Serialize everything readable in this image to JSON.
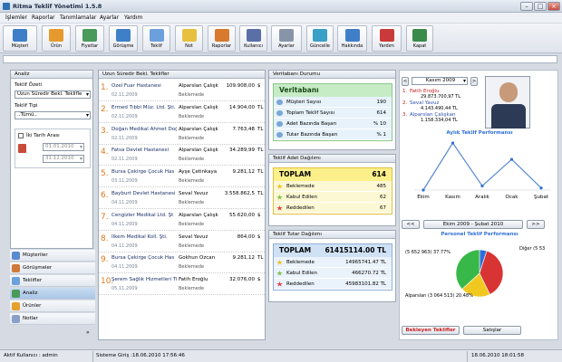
{
  "window": {
    "title": "Ritma Teklif Yönetimi 1.5.8"
  },
  "menu": [
    "İşlemler",
    "Raporlar",
    "Tanımlamalar",
    "Ayarlar",
    "Yardım"
  ],
  "toolbar": [
    {
      "label": "Müşteri",
      "color": "#3f7fc7",
      "icon": "customers-icon"
    },
    {
      "label": "Ürün",
      "color": "#e69a2e",
      "icon": "product-icon"
    },
    {
      "label": "Fiyatlar",
      "color": "#4a9a5a",
      "icon": "prices-icon"
    },
    {
      "label": "Görüşme",
      "color": "#3f7fc7",
      "icon": "meeting-icon"
    },
    {
      "label": "Teklif",
      "color": "#6ca0dc",
      "icon": "offer-icon"
    },
    {
      "label": "Not",
      "color": "#e8c040",
      "icon": "note-icon"
    },
    {
      "label": "Raporlar",
      "color": "#d9792e",
      "icon": "reports-icon"
    },
    {
      "label": "Kullanıcı",
      "color": "#5a6fa8",
      "icon": "user-icon"
    },
    {
      "label": "Ayarlar",
      "color": "#8895a8",
      "icon": "settings-icon"
    },
    {
      "label": "Güncelle",
      "color": "#3aa0c8",
      "icon": "update-icon"
    },
    {
      "label": "Hakkında",
      "color": "#3f7fc7",
      "icon": "about-icon"
    },
    {
      "label": "Yardım",
      "color": "#c93a3a",
      "icon": "help-icon"
    },
    {
      "label": "Kapat",
      "color": "#3a8a4a",
      "icon": "exit-icon"
    }
  ],
  "analysis": {
    "header": "Analiz",
    "summary_label": "Teklif Özeti",
    "summary_value": "Uzun Süredir Bekl. Teklifle",
    "type_label": "Teklif Tipi",
    "type_value": "..Tümü..",
    "date_range_label": "İki Tarih Arası",
    "date_from": "01.01.2010",
    "date_to": "31.12.2010"
  },
  "nav": [
    "Müşteriler",
    "Görüşmeler",
    "Teklifler",
    "Analiz",
    "Ürünler",
    "Notlar"
  ],
  "offers": {
    "header": "Uzun Süredir Bekl. Teklifler",
    "rows": [
      {
        "n": "1.",
        "name": "Özel Fuar Hastanesi",
        "date": "02.11.2009",
        "user": "Alparslan Çalışk",
        "status": "Beklemede",
        "amount": "109.908,00",
        "cur": "$"
      },
      {
        "n": "2.",
        "name": "Ermed Tıbbi Müz. Ltd. Şti.",
        "date": "02.11.2009",
        "user": "Alparslan Çalışk",
        "status": "Beklemede",
        "amount": "14.904,00",
        "cur": "TL"
      },
      {
        "n": "3.",
        "name": "Doğan Medikal Ahmet Doğ",
        "date": "02.11.2009",
        "user": "Alparslan Çalışk",
        "status": "Beklemede",
        "amount": "7.763,48",
        "cur": "TL"
      },
      {
        "n": "4.",
        "name": "Fatsa Devlet Hastanesi",
        "date": "02.11.2009",
        "user": "Alparslan Çalışk",
        "status": "Beklemede",
        "amount": "34.289,99",
        "cur": "TL"
      },
      {
        "n": "5.",
        "name": "Bursa Çekirge Çocuk Has",
        "date": "03.11.2009",
        "user": "Ayşe Çetinkaya",
        "status": "Beklemede",
        "amount": "9.281,12",
        "cur": "TL"
      },
      {
        "n": "6.",
        "name": "Bayburt Devlet Hastanesi",
        "date": "04.11.2009",
        "user": "Seval Yavuz",
        "status": "Beklemede",
        "amount": "3.558.862,5",
        "cur": "TL"
      },
      {
        "n": "7.",
        "name": "Cengizler Medikal Ltd. Şt",
        "date": "04.11.2009",
        "user": "Alparslan Çalışk",
        "status": "Beklemede",
        "amount": "55.620,00",
        "cur": "$"
      },
      {
        "n": "8.",
        "name": "İlkem Medikal Koll. Şti.",
        "date": "04.11.2009",
        "user": "Seval Yavuz",
        "status": "Beklemede",
        "amount": "864,00",
        "cur": "$"
      },
      {
        "n": "9.",
        "name": "Bursa Çekirge Çocuk Has",
        "date": "04.11.2009",
        "user": "Gokhun Özcan",
        "status": "Beklemede",
        "amount": "9.281,12",
        "cur": "TL"
      },
      {
        "n": "10.",
        "name": "Şerem Sağlık Hizmetleri Ti",
        "date": "05.11.2009",
        "user": "Fatih Eroğlu",
        "status": "Beklemede",
        "amount": "32.076,00",
        "cur": "$"
      }
    ]
  },
  "db": {
    "header": "Veritabanı Durumu",
    "title": "Veritabanı",
    "rows": [
      {
        "label": "Müşteri Sayısı",
        "value": "190"
      },
      {
        "label": "Toplam Teklif Sayısı",
        "value": "614"
      },
      {
        "label": "Adet Bazında Başarı",
        "value": "% 10"
      },
      {
        "label": "Tutar Bazında Başarı",
        "value": "% 1"
      }
    ]
  },
  "count": {
    "header": "Teklif Adet Dağılımı",
    "total_label": "TOPLAM",
    "total_value": "614",
    "rows": [
      {
        "label": "Beklemede",
        "value": "485",
        "color": "#f0c020"
      },
      {
        "label": "Kabul Edilen",
        "value": "62",
        "color": "#7cc04a"
      },
      {
        "label": "Reddedilen",
        "value": "67",
        "color": "#e04040"
      }
    ]
  },
  "amount": {
    "header": "Teklif Tutar Dağılımı",
    "total_label": "TOPLAM",
    "total_value": "61415114.00 TL",
    "rows": [
      {
        "label": "Beklemede",
        "value": "14965741.47 TL",
        "color": "#f0c020"
      },
      {
        "label": "Kabul Edilen",
        "value": "466270.72 TL",
        "color": "#7cc04a"
      },
      {
        "label": "Reddedilen",
        "value": "45983101.82 TL",
        "color": "#e04040"
      }
    ]
  },
  "period": {
    "month": "Kasım 2009",
    "prev": "<",
    "next": ">"
  },
  "ranking": [
    {
      "n": "1.",
      "name": "Fatih Eroğlu",
      "amount": "29.873.700,97 TL"
    },
    {
      "n": "2.",
      "name": "Seval Yavuz",
      "amount": "4.143.490,44 TL"
    },
    {
      "n": "3.",
      "name": "Alparslan Çalışkan",
      "amount": "1.158.334,04 TL"
    }
  ],
  "chart_data": [
    {
      "type": "line",
      "title": "Aylık Teklif Performansı",
      "categories": [
        "Ekim",
        "Kasım",
        "Aralık",
        "Ocak",
        "Şubat"
      ],
      "values": [
        0,
        230,
        20,
        150,
        10
      ]
    },
    {
      "type": "pie",
      "title": "Personel Teklif Performansı",
      "range_label": "Ekim 2009 - Şubat 2010",
      "prev": "<<",
      "next": ">>",
      "slices": [
        {
          "label": "Diğer (5 53",
          "value": 5,
          "color": "#2f6fd8"
        },
        {
          "label": "(5 652 963) 37.77%",
          "value": 37.77,
          "color": "#d83434"
        },
        {
          "label": "Alparslan (3 064 513) 20.48%",
          "value": 20.48,
          "color": "#f0c820"
        },
        {
          "label": "",
          "value": 36.75,
          "color": "#38b848"
        }
      ]
    }
  ],
  "actions": {
    "waiting": "Bekleyen Teklifler",
    "sales": "Satışlar"
  },
  "status": {
    "user": "Aktif Kullanıcı : admin",
    "login": "Sisteme Giriş :18.06.2010 17:56:46",
    "now": "18.06.2010 18:01:58"
  }
}
